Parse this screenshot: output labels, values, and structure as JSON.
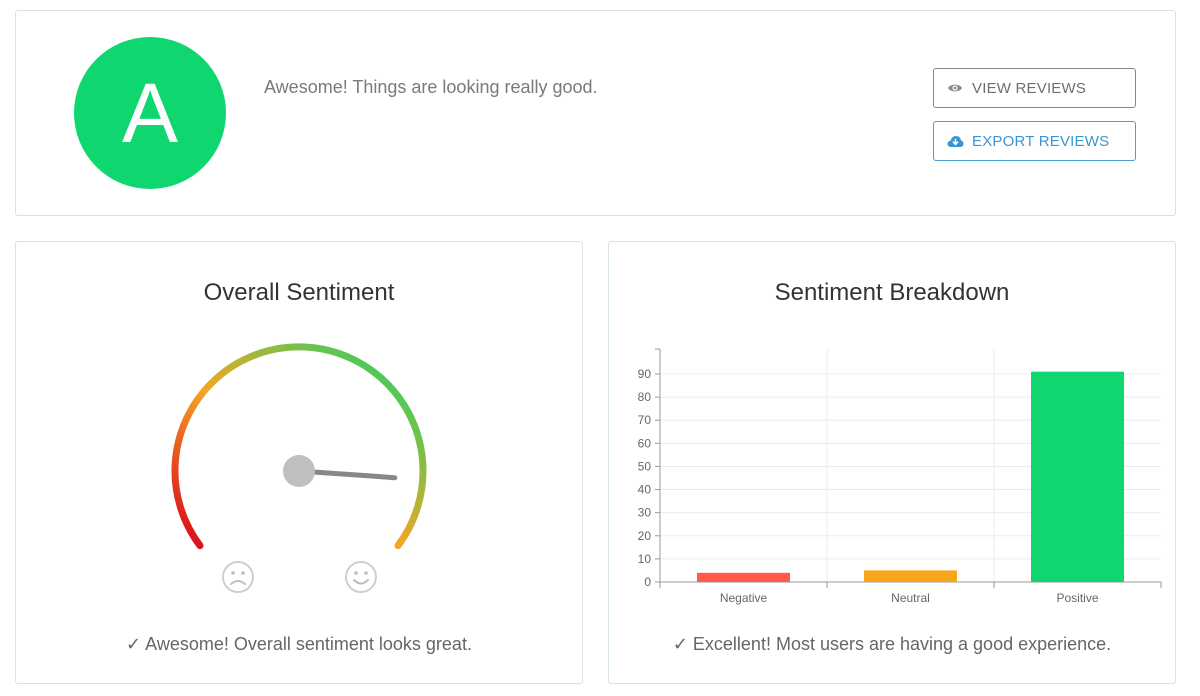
{
  "header": {
    "grade": "A",
    "grade_color": "#0fd66e",
    "message": "Awesome! Things are looking really good.",
    "view_reviews_label": "VIEW REVIEWS",
    "export_reviews_label": "EXPORT REVIEWS",
    "view_icon": "eye-icon",
    "export_icon": "cloud-download-icon"
  },
  "overall_sentiment": {
    "title": "Overall Sentiment",
    "gauge_value": 0.87,
    "gauge_colors": [
      "#d9001b",
      "#f5a623",
      "#0fd66e"
    ],
    "left_icon": "sad-face-icon",
    "right_icon": "happy-face-icon",
    "footer": "✓ Awesome! Overall sentiment looks great."
  },
  "sentiment_breakdown": {
    "title": "Sentiment Breakdown",
    "footer": "✓ Excellent! Most users are having a good experience."
  },
  "chart_data": {
    "type": "bar",
    "categories": [
      "Negative",
      "Neutral",
      "Positive"
    ],
    "values": [
      4,
      5,
      91
    ],
    "colors": [
      "#ff5a4a",
      "#f7a61c",
      "#0fd66e"
    ],
    "yticks": [
      0,
      10,
      20,
      30,
      40,
      50,
      60,
      70,
      80,
      90
    ],
    "ylim": [
      0,
      100
    ],
    "grid": true,
    "title": "",
    "xlabel": "",
    "ylabel": ""
  }
}
